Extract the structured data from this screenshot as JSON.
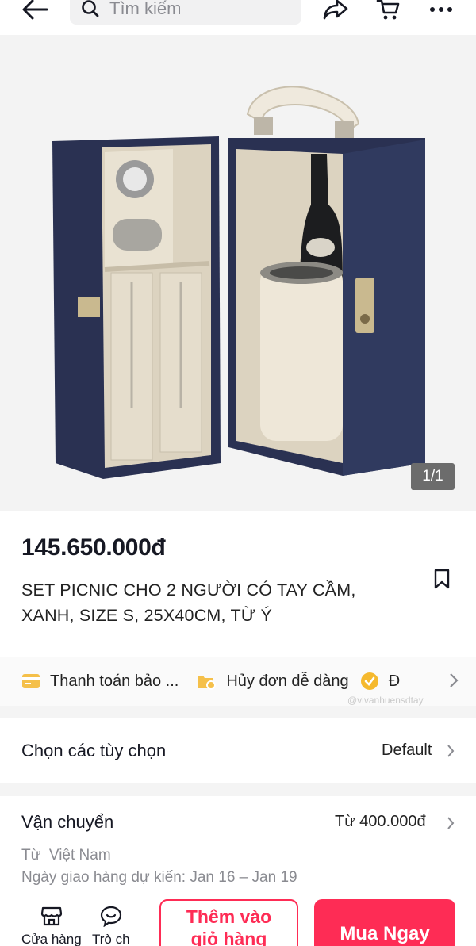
{
  "header": {
    "search_placeholder": "Tìm kiếm",
    "icons": [
      "back-arrow-icon",
      "search-icon",
      "share-icon",
      "cart-icon",
      "more-icon"
    ]
  },
  "gallery": {
    "counter": "1/1"
  },
  "product": {
    "price": "145.650.000đ",
    "title": "SET PICNIC CHO 2 NGƯỜI CÓ TAY CẦM, XANH, SIZE S, 25X40CM, TỪ Ý"
  },
  "benefits": [
    {
      "icon": "card-icon",
      "label": "Thanh toán bảo ..."
    },
    {
      "icon": "cancel-order-icon",
      "label": "Hủy đơn dễ dàng"
    },
    {
      "icon": "verified-icon",
      "label": "Đ"
    }
  ],
  "watermark": "@vivanhuensdtay",
  "options": {
    "label": "Chọn các tùy chọn",
    "value": "Default"
  },
  "shipping": {
    "label": "Vận chuyển",
    "value": "Từ 400.000đ",
    "origin": "Từ  Việt Nam",
    "eta": "Ngày giao hàng dự kiến: Jan 16 – Jan 19"
  },
  "bottom_bar": {
    "shop_label": "Cửa hàng",
    "chat_label": "Trò ch",
    "add_to_cart_line1": "Thêm vào",
    "add_to_cart_line2": "giỏ hàng",
    "buy_now": "Mua Ngay"
  },
  "colors": {
    "accent": "#fe2c55",
    "case_blue": "#2b3354",
    "lining": "#e9e2d2"
  }
}
